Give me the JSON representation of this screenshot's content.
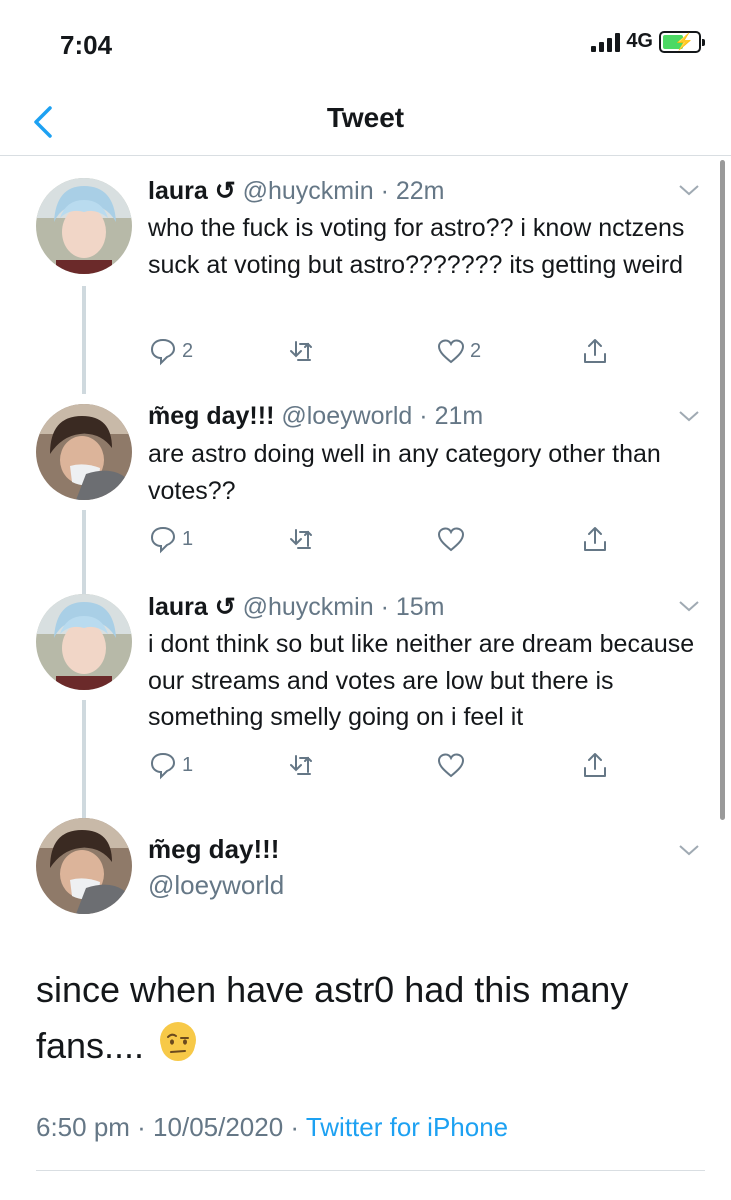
{
  "status_bar": {
    "time": "7:04",
    "network": "4G",
    "battery_level": 0.6,
    "battery_color": "#4cd964"
  },
  "nav": {
    "back_icon": "chevron-left-icon",
    "title": "Tweet"
  },
  "replies": [
    {
      "name": "laura",
      "name_suffix": "↺",
      "handle": "@huyckmin",
      "time": "· 22m",
      "text": "who the fuck is voting for astro?? i know nctzens suck at voting but astro??????? its getting weird",
      "reply_count": "2",
      "retweet_count": "",
      "like_count": "2"
    },
    {
      "name": "m̃eg day!!!",
      "name_suffix": "",
      "handle": "@loeyworld",
      "time": "· 21m",
      "text": "are astro doing well in any category other than votes??",
      "reply_count": "1",
      "retweet_count": "",
      "like_count": ""
    },
    {
      "name": "laura",
      "name_suffix": "↺",
      "handle": "@huyckmin",
      "time": "· 15m",
      "text": "i dont think so but like neither are dream because our streams and votes are low but there is something smelly going on i feel it",
      "reply_count": "1",
      "retweet_count": "",
      "like_count": ""
    }
  ],
  "main_tweet": {
    "name": "m̃eg day!!!",
    "handle": "@loeyworld",
    "text": "since when have astr0 had this many fans....",
    "emoji": "raised-eyebrow-face",
    "timestamp": "6:50 pm · 10/05/2020 ·",
    "source": "Twitter for iPhone"
  },
  "colors": {
    "accent": "#1da1f2",
    "secondary_text": "#657786",
    "thread_line": "#cfd9de"
  }
}
